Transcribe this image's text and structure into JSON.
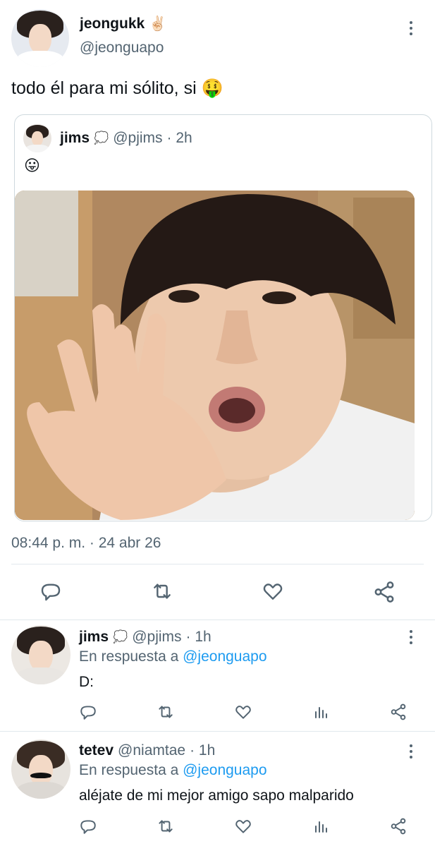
{
  "main_tweet": {
    "display_name": "jeongukk",
    "name_emoji": "✌🏻",
    "handle": "@jeonguapo",
    "text": "todo él para mi sólito, si 🤑",
    "timestamp": "08:44 p. m. · 24 abr 26"
  },
  "quoted_tweet": {
    "display_name": "jims",
    "name_emoji": "💭",
    "handle": "@pjims",
    "time": "· 2h",
    "text": "😛"
  },
  "replies": [
    {
      "display_name": "jims",
      "name_emoji": "💭",
      "handle": "@pjims",
      "time": "· 1h",
      "reply_prefix": "En respuesta a",
      "reply_to": "@jeonguapo",
      "text": "D:"
    },
    {
      "display_name": "tetev",
      "handle": "@niamtae",
      "time": "· 1h",
      "reply_prefix": "En respuesta a",
      "reply_to": "@jeonguapo",
      "text": "aléjate de mi mejor amigo sapo malparido"
    }
  ],
  "icons": {
    "more": "more-vertical-icon",
    "reply": "reply-icon",
    "retweet": "retweet-icon",
    "like": "like-icon",
    "share": "share-icon",
    "analytics": "analytics-icon"
  },
  "colors": {
    "text": "#0f1419",
    "muted": "#536471",
    "link": "#1d9bf0",
    "divider": "#e1e8ed"
  }
}
